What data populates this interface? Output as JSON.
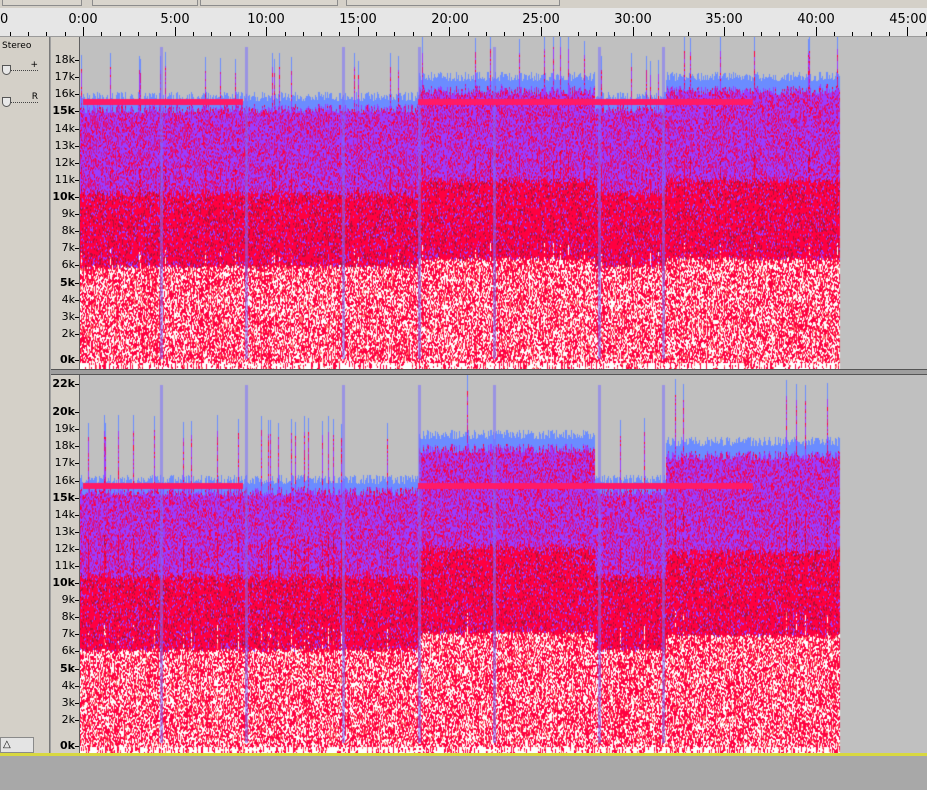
{
  "ruler": {
    "labels": [
      "0",
      "0:00",
      "5:00",
      "10:00",
      "15:00",
      "20:00",
      "25:00",
      "30:00",
      "35:00",
      "40:00",
      "45:00"
    ]
  },
  "track": {
    "name": "Stereo",
    "gain_symbol": "+",
    "pan_symbol": "R",
    "collapse_symbol": "△"
  },
  "scales": {
    "top": [
      "18k",
      "17k",
      "16k",
      "15k",
      "14k",
      "13k",
      "12k",
      "11k",
      "10k",
      "9k",
      "8k",
      "7k",
      "6k",
      "5k",
      "4k",
      "3k",
      "2k",
      "0k"
    ],
    "bottom": [
      "22k",
      "20k",
      "19k",
      "18k",
      "17k",
      "16k",
      "15k",
      "14k",
      "13k",
      "12k",
      "11k",
      "10k",
      "9k",
      "8k",
      "7k",
      "6k",
      "5k",
      "4k",
      "3k",
      "2k",
      "0k"
    ]
  },
  "colors": {
    "background": "#c0c0c0",
    "low": "#ff0040",
    "mid": "#9b3cff",
    "high": "#ffffff",
    "band": "#ff1a66"
  }
}
